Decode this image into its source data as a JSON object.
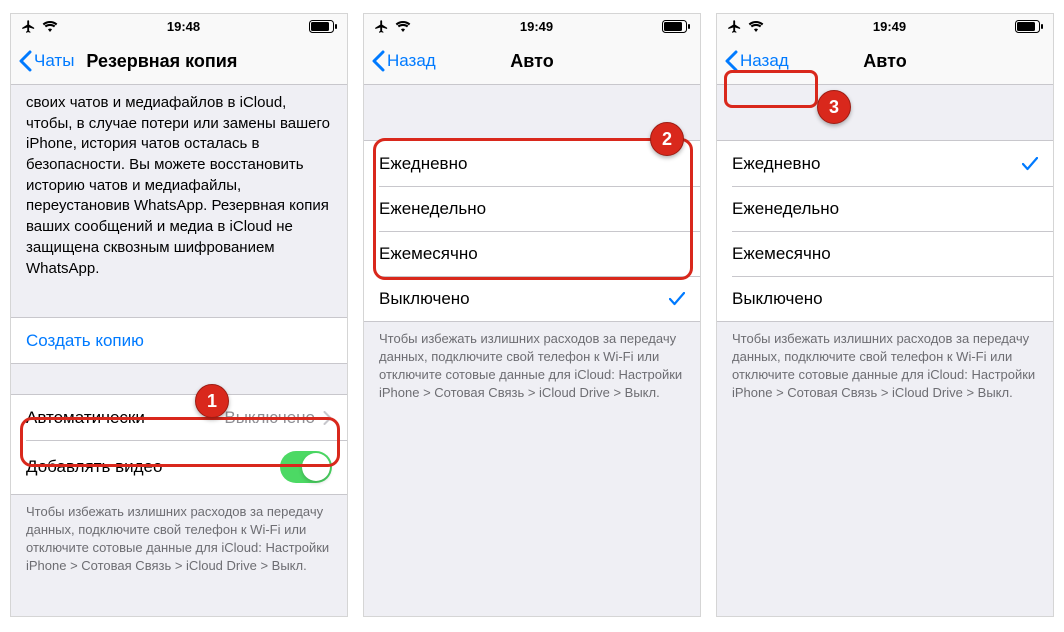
{
  "screens": [
    {
      "status_time": "19:48",
      "nav_back": "Чаты",
      "nav_title": "Резервная копия",
      "desc": "своих чатов и медиафайлов в iCloud, чтобы, в случае потери или замены вашего iPhone, история чатов осталась в безопасности. Вы можете восстановить историю чатов и медиафайлы, переустановив WhatsApp. Резервная копия ваших сообщений и медиа в iCloud не защищена сквозным шифрованием WhatsApp.",
      "create_backup": "Создать копию",
      "auto_label": "Автоматически",
      "auto_value": "Выключено",
      "add_video": "Добавлять видео",
      "footer": "Чтобы избежать излишних расходов за передачу данных, подключите свой телефон к Wi-Fi или отключите сотовые данные для iCloud: Настройки iPhone > Сотовая Связь > iCloud Drive > Выкл."
    },
    {
      "status_time": "19:49",
      "nav_back": "Назад",
      "nav_title": "Авто",
      "options": {
        "daily": "Ежедневно",
        "weekly": "Еженедельно",
        "monthly": "Ежемесячно",
        "off": "Выключено"
      },
      "footer": "Чтобы избежать излишних расходов за передачу данных, подключите свой телефон к Wi-Fi или отключите сотовые данные для iCloud: Настройки iPhone > Сотовая Связь > iCloud Drive > Выкл."
    },
    {
      "status_time": "19:49",
      "nav_back": "Назад",
      "nav_title": "Авто",
      "options": {
        "daily": "Ежедневно",
        "weekly": "Еженедельно",
        "monthly": "Ежемесячно",
        "off": "Выключено"
      },
      "footer": "Чтобы избежать излишних расходов за передачу данных, подключите свой телефон к Wi-Fi или отключите сотовые данные для iCloud: Настройки iPhone > Сотовая Связь > iCloud Drive > Выкл."
    }
  ],
  "badges": {
    "b1": "1",
    "b2": "2",
    "b3": "3"
  }
}
